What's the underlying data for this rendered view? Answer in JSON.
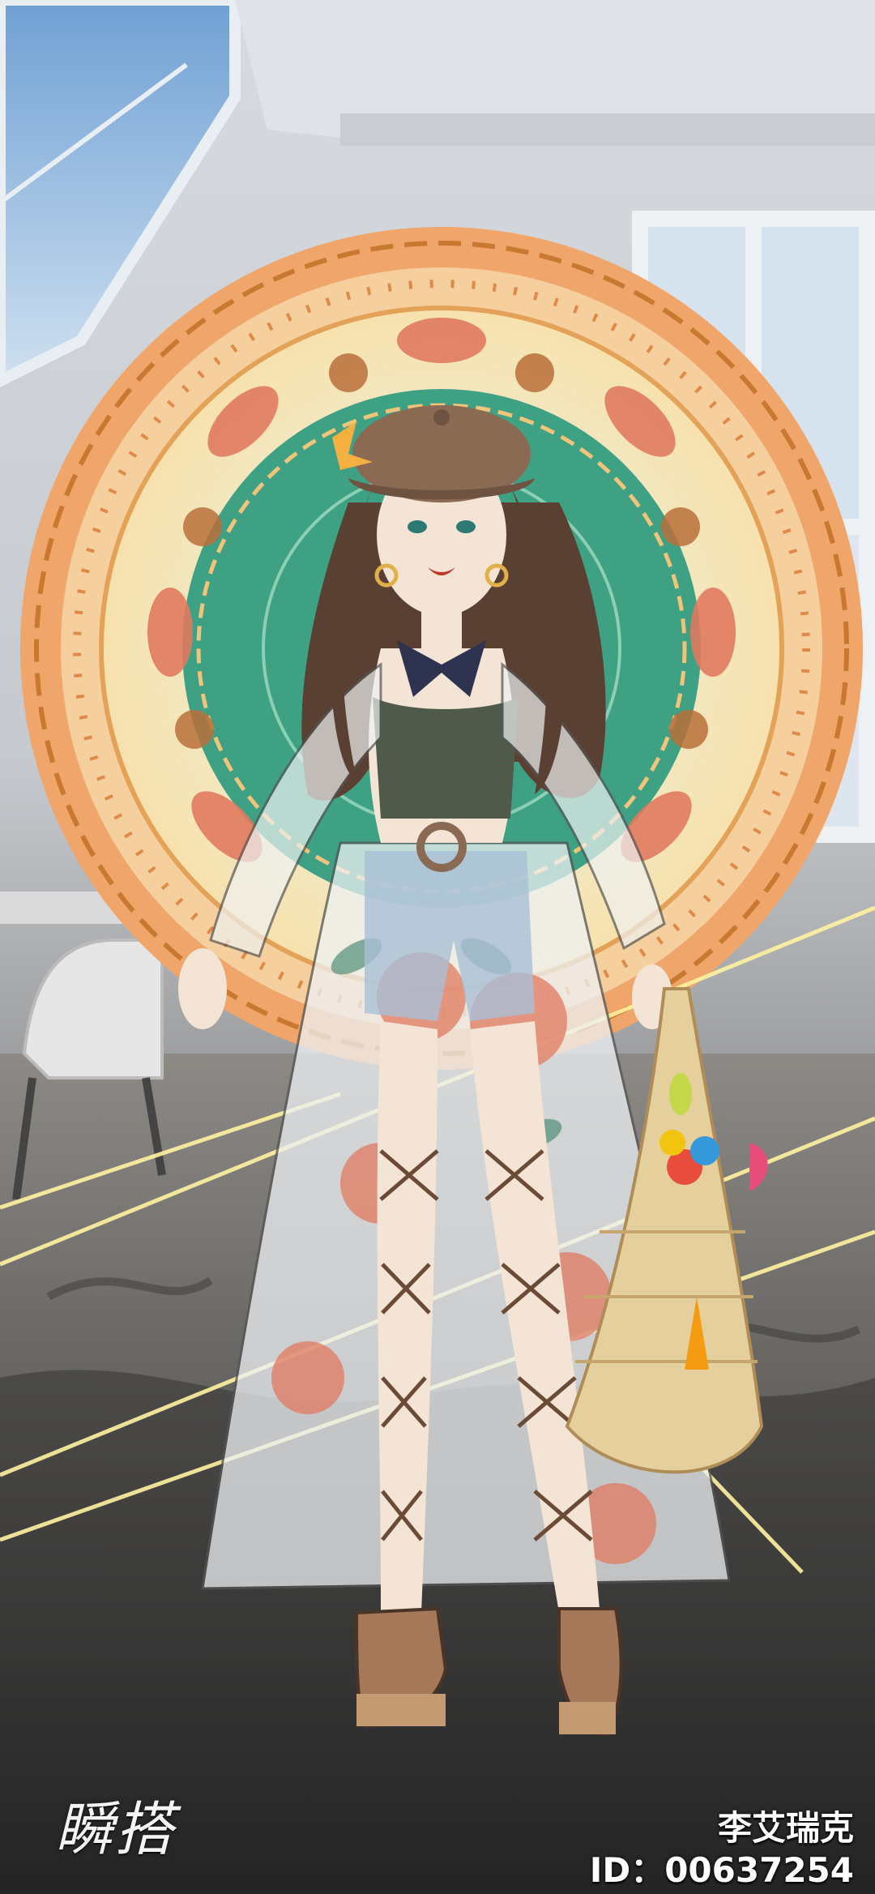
{
  "game": {
    "logo_text": "瞬搭",
    "player_name": "李艾瑞克",
    "player_id_label": "ID：00637254"
  },
  "colors": {
    "frame_orange": "#f0a66b",
    "frame_cream": "#f7e2ae",
    "mandala_green": "#3fa184",
    "hair_brown": "#5a4032",
    "hat_brown": "#8a6a52",
    "skirt_sheer": "#eef1f3",
    "flower_red": "#e07a5f",
    "shoe_brown": "#a5785a",
    "bag_straw": "#e5cf9d",
    "light_ray": "#fff3a0"
  },
  "scene": {
    "background": "studio-loft-room",
    "character": "fashion-model-character",
    "decoration": "ornamental-mandala-frame"
  }
}
